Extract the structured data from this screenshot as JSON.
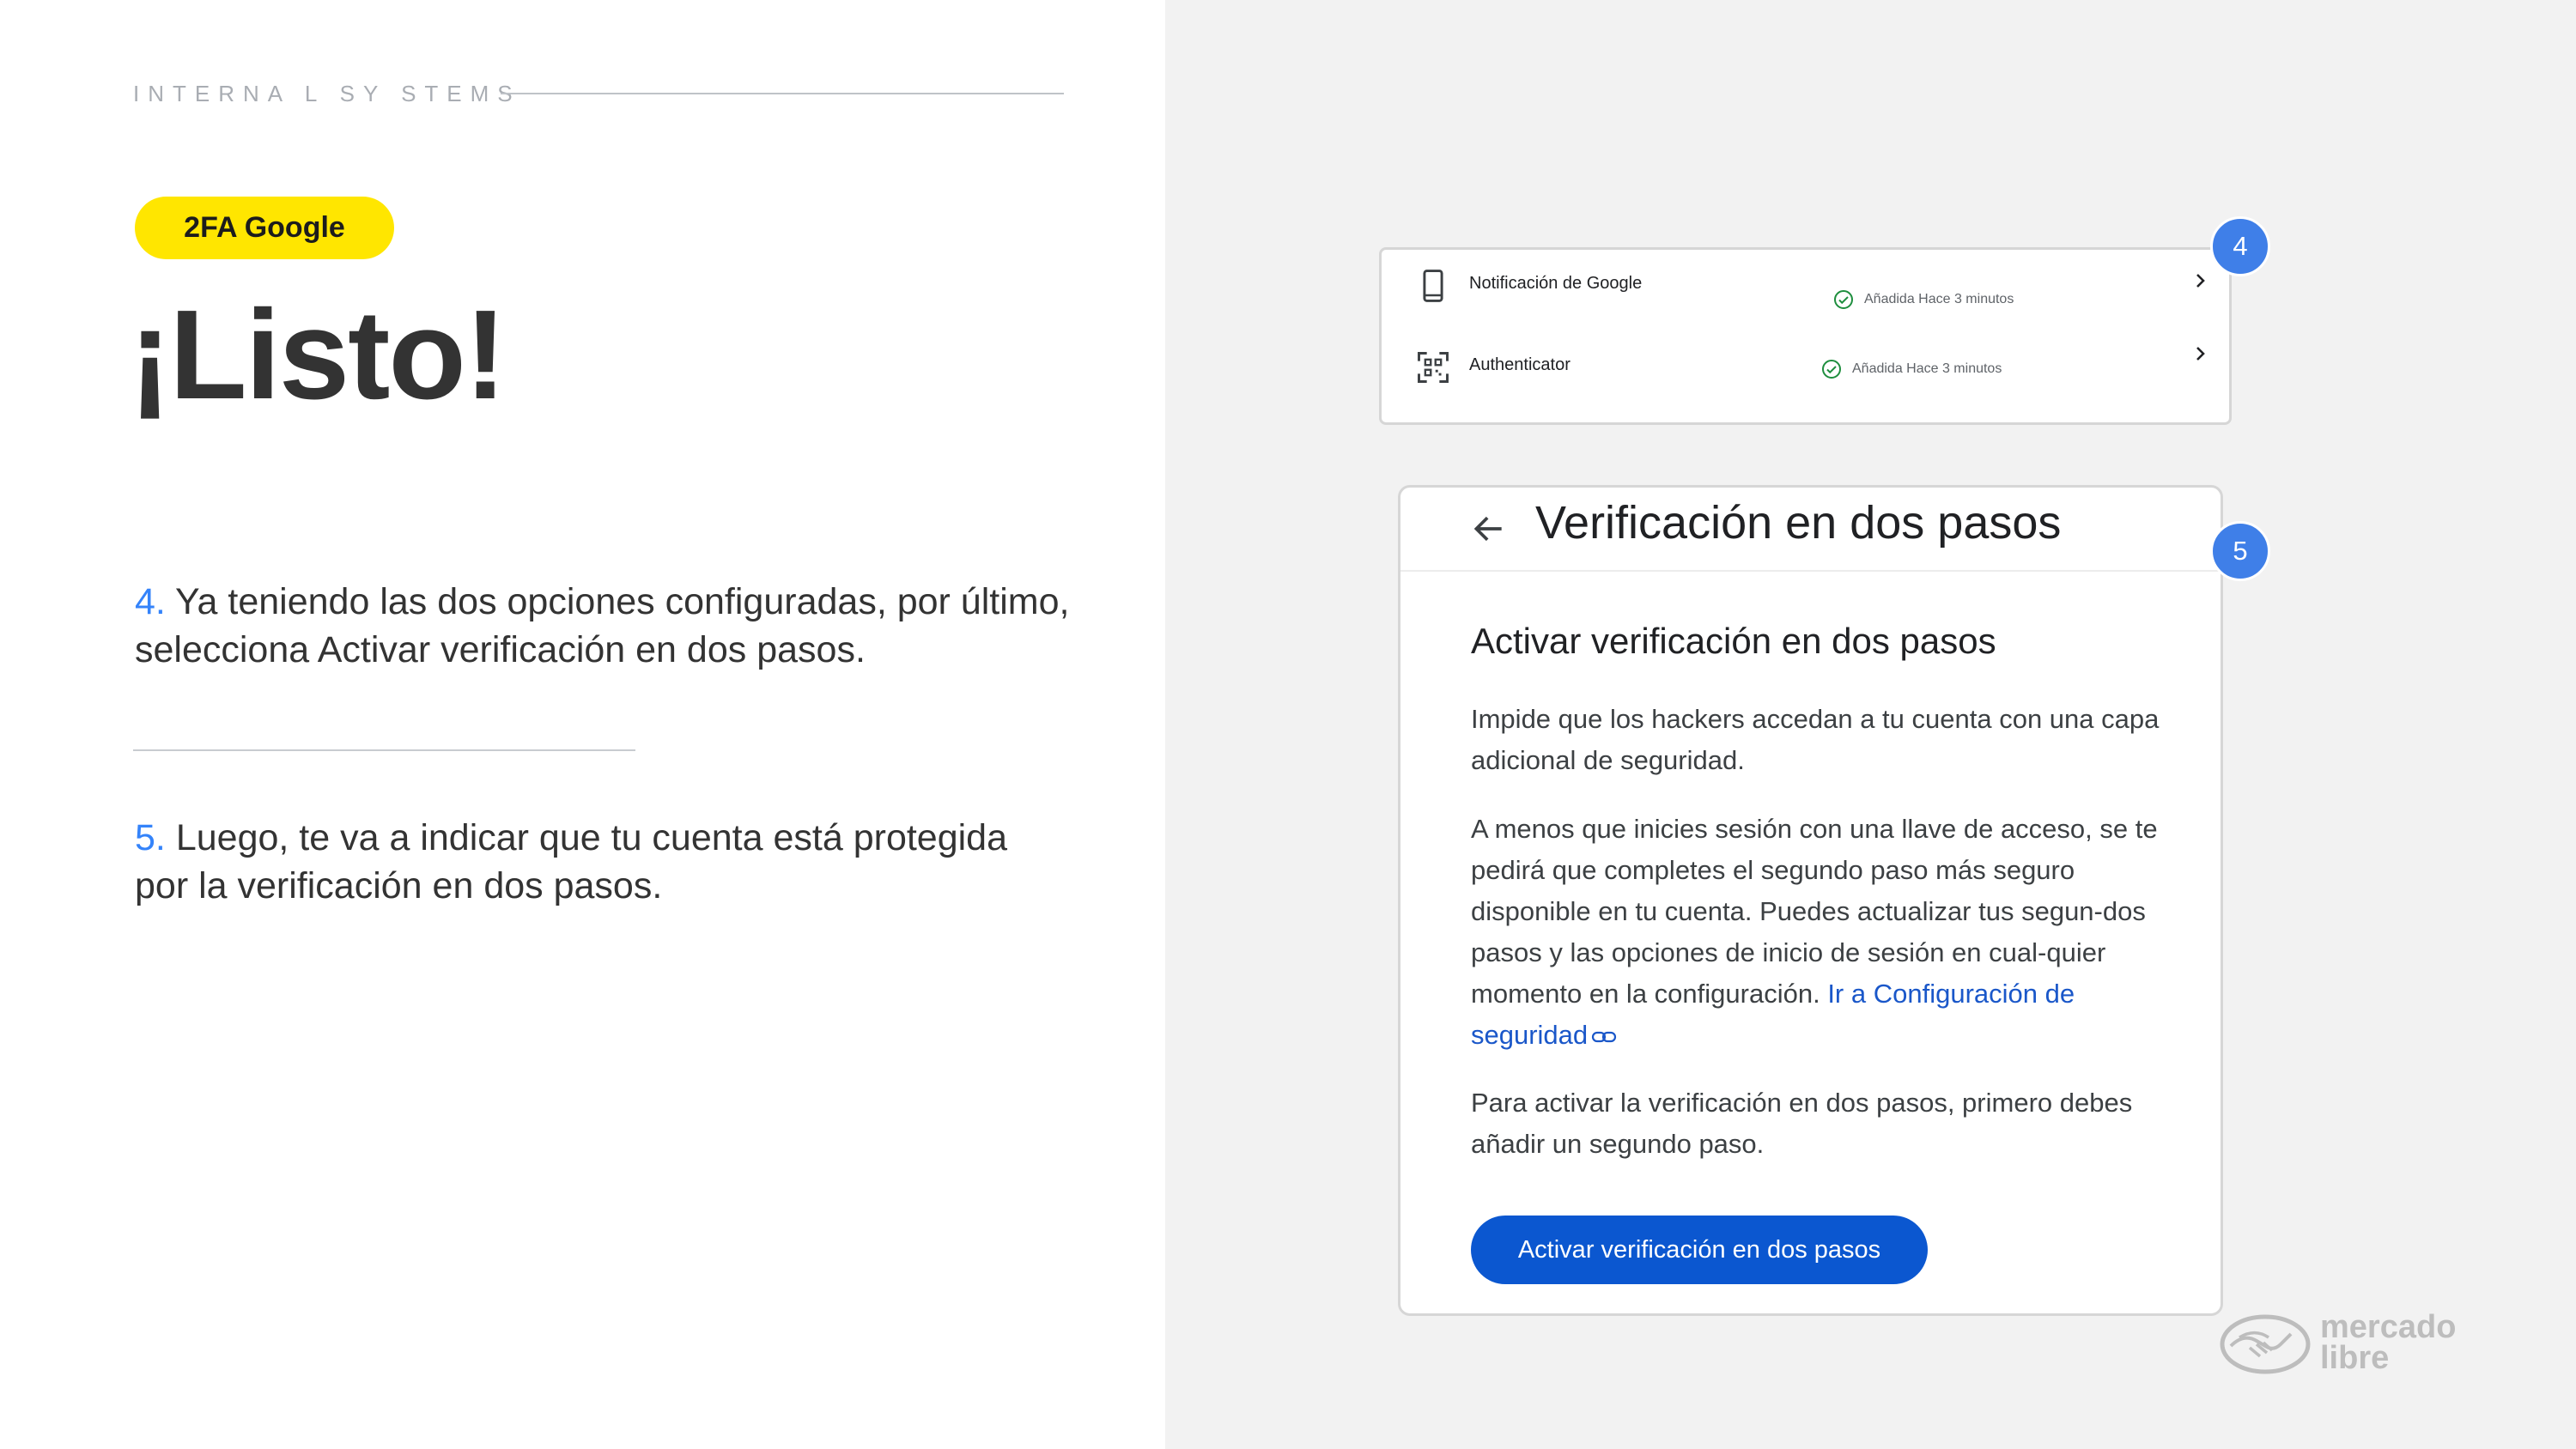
{
  "header": {
    "label": "INTERNA L SY STEMS"
  },
  "tag": {
    "label": "2FA Google"
  },
  "title": "¡Listo!",
  "steps": [
    {
      "num": "4.",
      "text": " Ya teniendo las dos opciones configuradas, por último, selecciona Activar verificación en dos pasos."
    },
    {
      "num": "5.",
      "text": " Luego, te va a indicar que tu cuenta está protegida por la verificación en dos pasos."
    }
  ],
  "auth_methods": {
    "items": [
      {
        "name": "Notificación de Google",
        "status": "Añadida Hace 3 minutos",
        "icon": "phone-icon"
      },
      {
        "name": "Authenticator",
        "status": "Añadida Hace 3 minutos",
        "icon": "qr-code-icon"
      }
    ],
    "badge": "4"
  },
  "two_step": {
    "title": "Verificación en dos pasos",
    "heading": "Activar verificación en dos pasos",
    "p1": "Impide que los hackers accedan a tu cuenta con una capa adicional de seguridad.",
    "p2": "A menos que inicies sesión con una llave de acceso, se te pedirá que completes el segundo paso más seguro disponible en tu cuenta. Puedes actualizar tus segun-dos pasos y las opciones de inicio de sesión en cual-quier momento en la configuración.",
    "p2_link": "Ir a Configuración de seguridad",
    "p3": "Para activar la verificación en dos pasos, primero debes añadir un segundo paso.",
    "button": "Activar verificación en dos pasos",
    "badge": "5"
  },
  "brand": {
    "line1": "mercado",
    "line2": "libre"
  },
  "colors": {
    "accent": "#3483fa",
    "tag": "#ffe600",
    "google_button": "#0b57d0",
    "badge": "#3f7fe8",
    "check": "#1e8e3e"
  }
}
